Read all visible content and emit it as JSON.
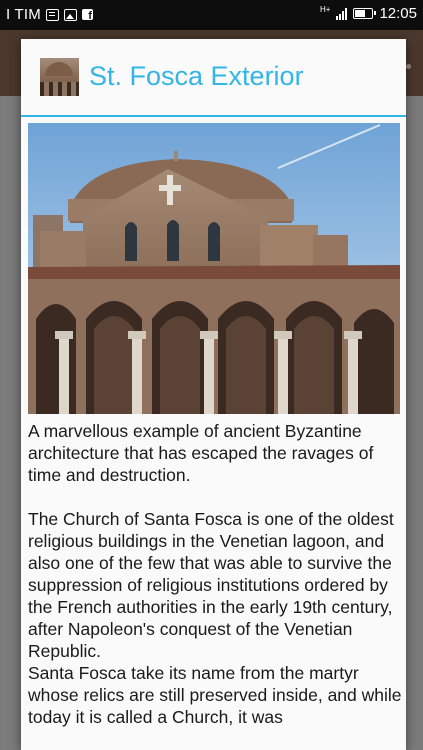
{
  "status_bar": {
    "carrier": "I TIM",
    "network_type": "H+",
    "time": "12:05",
    "icons": [
      "message-icon",
      "image-icon",
      "facebook-icon",
      "signal-icon",
      "battery-icon"
    ]
  },
  "dialog": {
    "title": "St. Fosca Exterior",
    "thumbnail": "church-thumbnail",
    "accent_color": "#33b5e5",
    "paragraphs": [
      "A marvellous example of ancient Byzantine architecture that has escaped the ravages of time and destruction.",
      "The Church of Santa Fosca is one of the oldest religious buildings in the Venetian lagoon, and also one of the few that was able to survive the suppression of religious institutions ordered by the French authorities in the early 19th century, after Napoleon's conquest of the Venetian Republic.",
      "Santa Fosca take its name from the martyr whose relics are still preserved inside, and while today it is called a Church, it was"
    ]
  }
}
